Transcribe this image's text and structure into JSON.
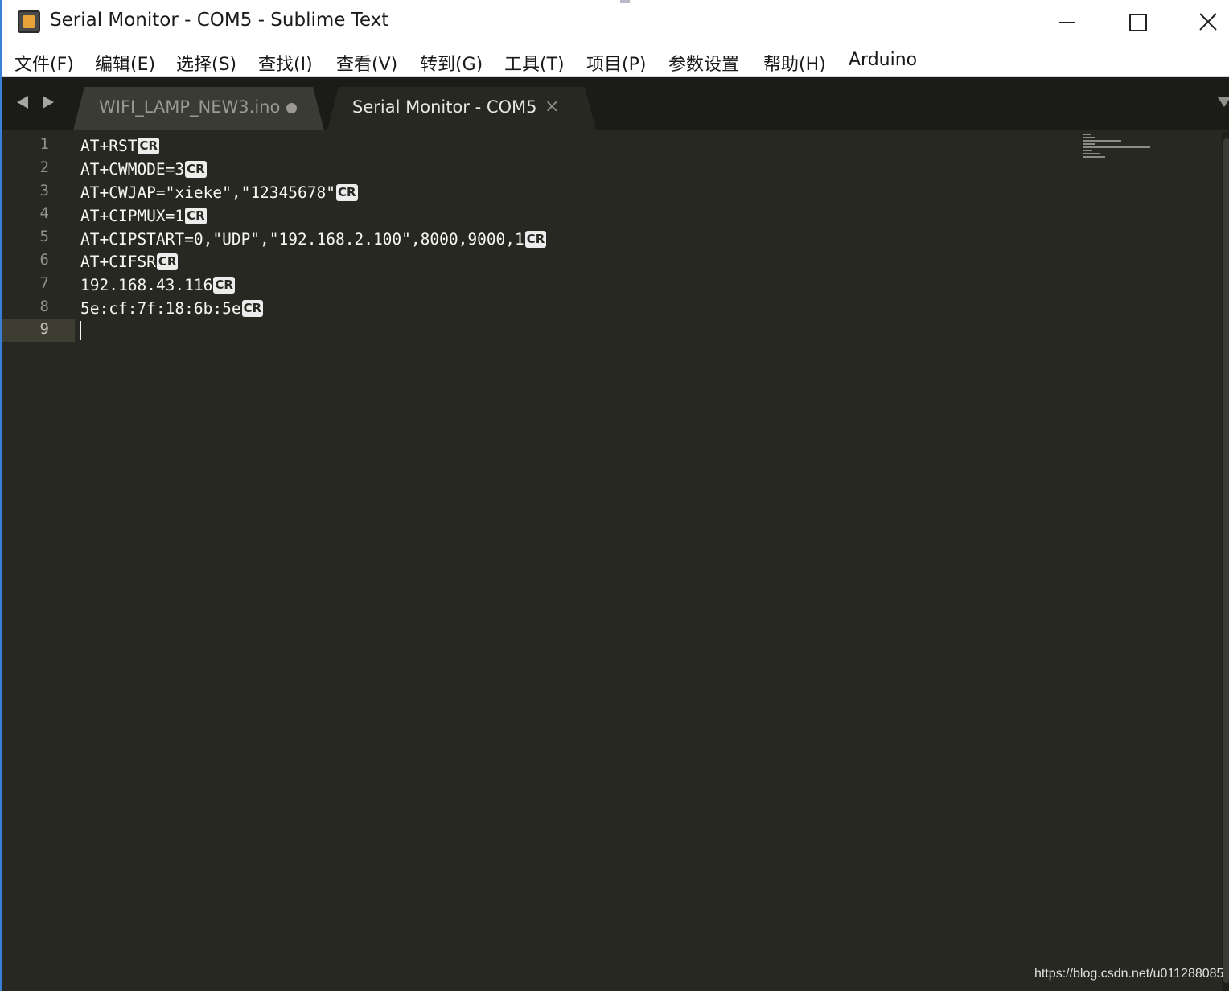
{
  "window": {
    "title": "Serial Monitor - COM5 - Sublime Text",
    "accent_color": "#3c7fd9"
  },
  "menu": {
    "items": [
      "文件(F)",
      "编辑(E)",
      "选择(S)",
      "查找(I)",
      "查看(V)",
      "转到(G)",
      "工具(T)",
      "项目(P)",
      "参数设置",
      "帮助(H)",
      "Arduino"
    ]
  },
  "tabs": [
    {
      "label": "WIFI_LAMP_NEW3.ino",
      "active": false,
      "modified": true
    },
    {
      "label": "Serial Monitor - COM5",
      "active": true,
      "close_icon": "close-icon"
    }
  ],
  "editor": {
    "background": "#272822",
    "current_line": 9,
    "lines": [
      {
        "num": "1",
        "text": "AT+RST",
        "eol": "CR"
      },
      {
        "num": "2",
        "text": "AT+CWMODE=3",
        "eol": "CR"
      },
      {
        "num": "3",
        "text": "AT+CWJAP=\"xieke\",\"12345678\"",
        "eol": "CR"
      },
      {
        "num": "4",
        "text": "AT+CIPMUX=1",
        "eol": "CR"
      },
      {
        "num": "5",
        "text": "AT+CIPSTART=0,\"UDP\",\"192.168.2.100\",8000,9000,1",
        "eol": "CR"
      },
      {
        "num": "6",
        "text": "AT+CIFSR",
        "eol": "CR"
      },
      {
        "num": "7",
        "text": "192.168.43.116",
        "eol": "CR"
      },
      {
        "num": "8",
        "text": "5e:cf:7f:18:6b:5e",
        "eol": "CR"
      },
      {
        "num": "9",
        "text": "",
        "eol": ""
      }
    ]
  },
  "watermark": "https://blog.csdn.net/u011288085"
}
